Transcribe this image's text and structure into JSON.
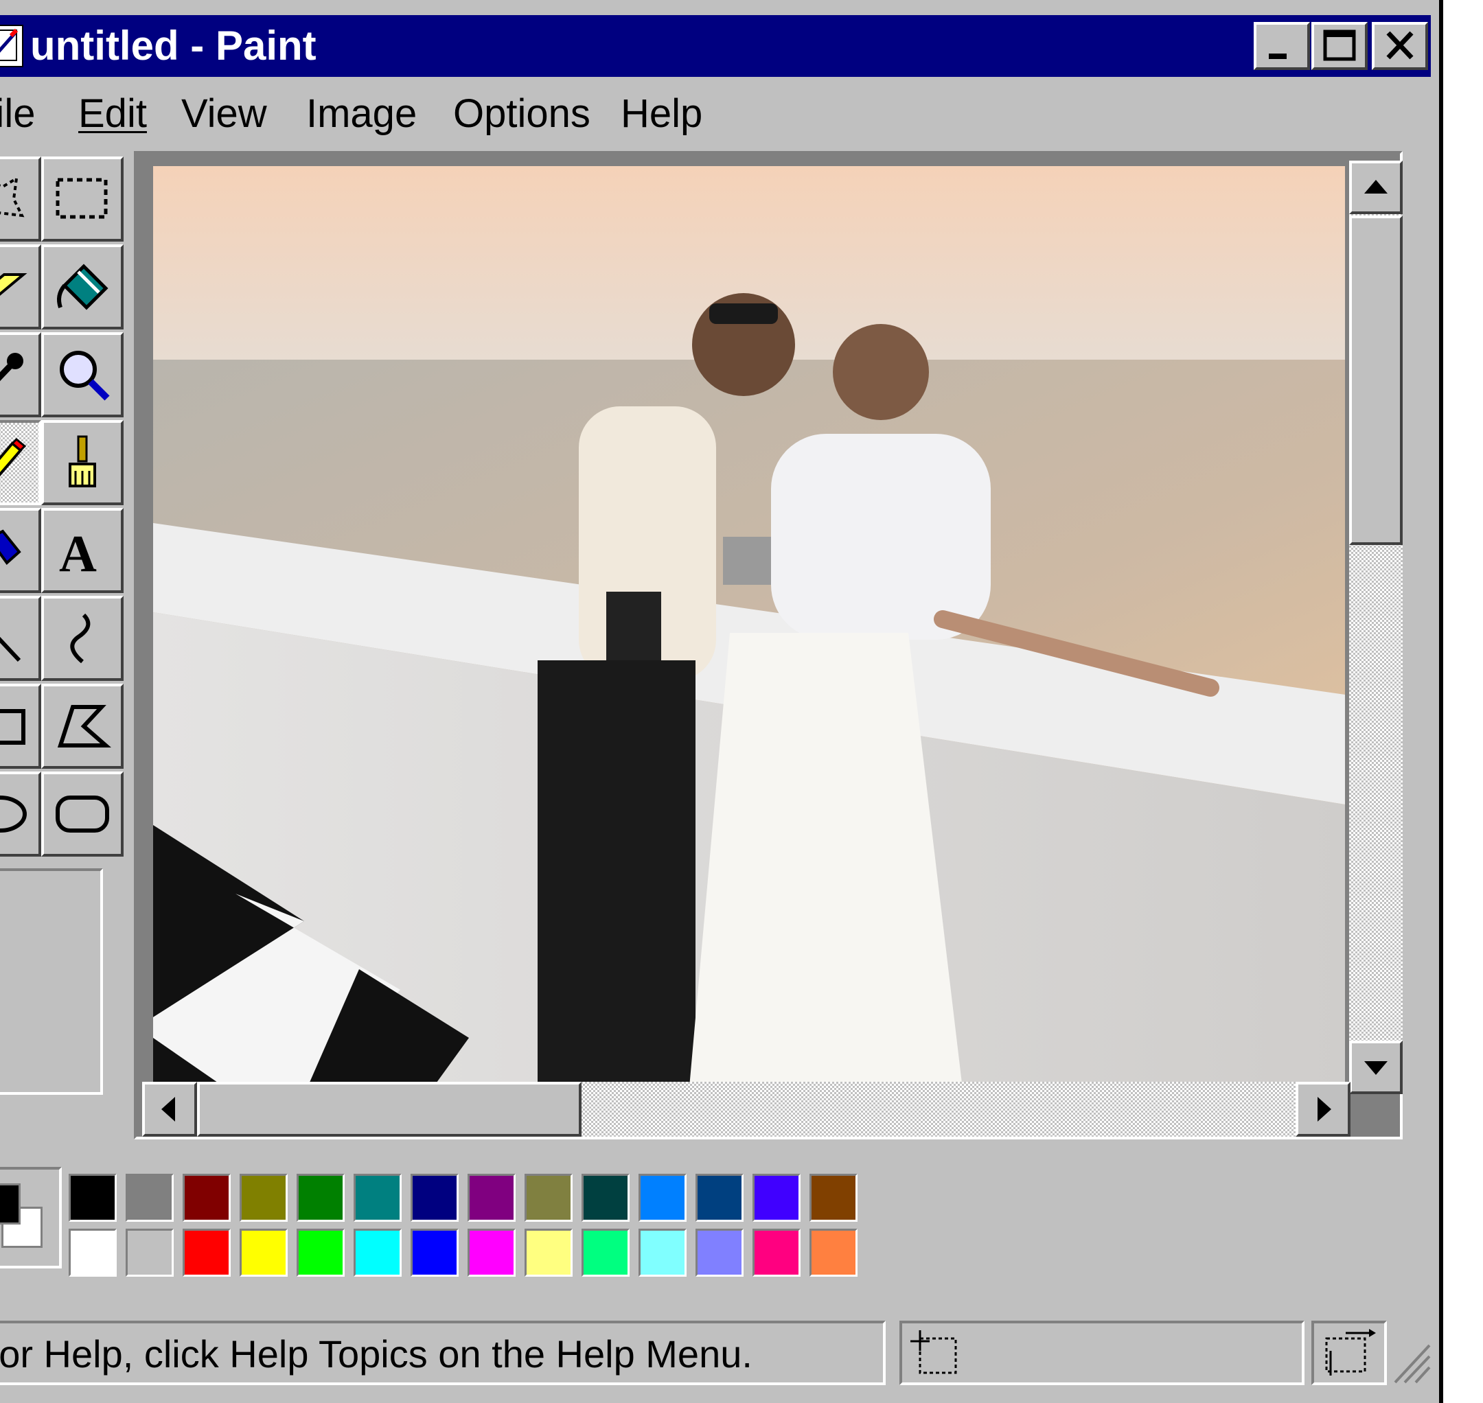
{
  "window": {
    "title": "untitled - Paint",
    "controls": {
      "minimize": "minimize-icon",
      "maximize": "maximize-icon",
      "close": "close-icon"
    }
  },
  "menu": {
    "items": [
      {
        "label": "File",
        "accesskey": "F"
      },
      {
        "label": "Edit",
        "accesskey": "E"
      },
      {
        "label": "View",
        "accesskey": "V"
      },
      {
        "label": "Image",
        "accesskey": "I"
      },
      {
        "label": "Options",
        "accesskey": "O"
      },
      {
        "label": "Help",
        "accesskey": "H"
      }
    ]
  },
  "tools": [
    {
      "name": "free-form-select",
      "icon": "free-form-select-icon"
    },
    {
      "name": "select",
      "icon": "rect-select-icon"
    },
    {
      "name": "eraser",
      "icon": "eraser-icon"
    },
    {
      "name": "fill-with-color",
      "icon": "paint-bucket-icon"
    },
    {
      "name": "pick-color",
      "icon": "eyedropper-icon"
    },
    {
      "name": "magnifier",
      "icon": "magnifier-icon"
    },
    {
      "name": "pencil",
      "icon": "pencil-icon",
      "selected": true
    },
    {
      "name": "brush",
      "icon": "brush-icon"
    },
    {
      "name": "airbrush",
      "icon": "airbrush-icon"
    },
    {
      "name": "text",
      "icon": "text-icon"
    },
    {
      "name": "line",
      "icon": "line-icon"
    },
    {
      "name": "curve",
      "icon": "curve-icon"
    },
    {
      "name": "rectangle",
      "icon": "rectangle-icon"
    },
    {
      "name": "polygon",
      "icon": "polygon-icon"
    },
    {
      "name": "ellipse",
      "icon": "ellipse-icon"
    },
    {
      "name": "rounded-rectangle",
      "icon": "rounded-rectangle-icon"
    }
  ],
  "canvas": {
    "image": "photo of a couple in white and black outfits holding vintage cameras on a seaside terrace at sunset"
  },
  "palette": {
    "foreground": "#000000",
    "background": "#ffffff",
    "top_row": [
      "#000000",
      "#808080",
      "#800000",
      "#808000",
      "#008000",
      "#008080",
      "#000080",
      "#800080",
      "#808040",
      "#004040",
      "#0080ff",
      "#004080",
      "#4000ff",
      "#804000"
    ],
    "bottom_row": [
      "#ffffff",
      "#c0c0c0",
      "#ff0000",
      "#ffff00",
      "#00ff00",
      "#00ffff",
      "#0000ff",
      "#ff00ff",
      "#ffff80",
      "#00ff80",
      "#80ffff",
      "#8080ff",
      "#ff0080",
      "#ff8040"
    ]
  },
  "status": {
    "help_text": "For Help, click Help Topics on the Help Menu.",
    "position_icon": "cursor-position-icon",
    "size_icon": "selection-size-icon"
  }
}
